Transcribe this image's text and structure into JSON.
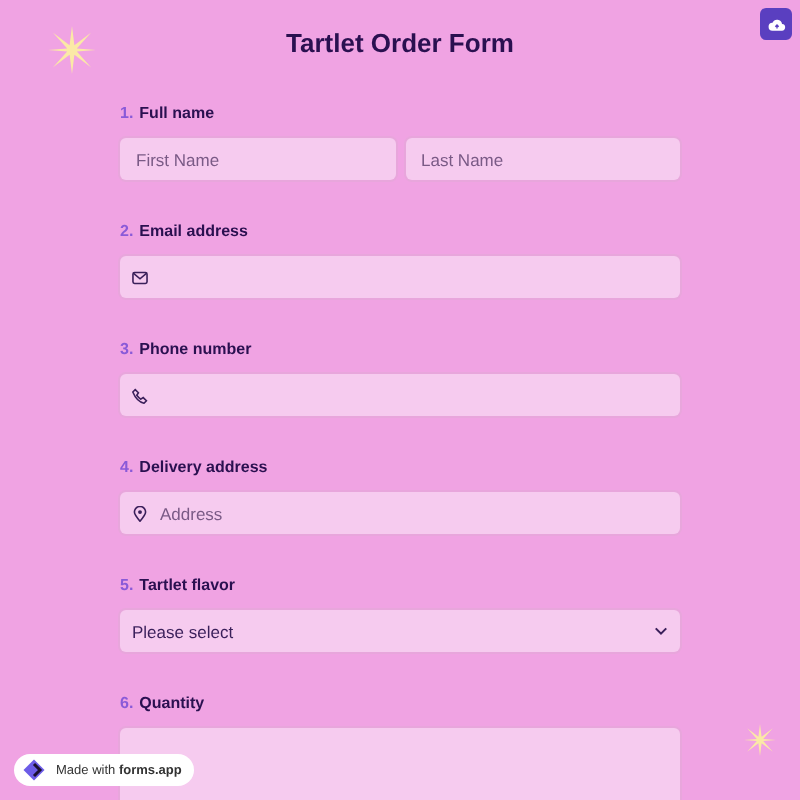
{
  "title": "Tartlet Order Form",
  "questions": [
    {
      "number": "1.",
      "label": "Full name",
      "kind": "name",
      "placeholders": [
        "First Name",
        "Last Name"
      ]
    },
    {
      "number": "2.",
      "label": "Email address",
      "kind": "email"
    },
    {
      "number": "3.",
      "label": "Phone number",
      "kind": "phone"
    },
    {
      "number": "4.",
      "label": "Delivery address",
      "kind": "address",
      "placeholder": "Address"
    },
    {
      "number": "5.",
      "label": "Tartlet flavor",
      "kind": "select",
      "value": "Please select"
    },
    {
      "number": "6.",
      "label": "Quantity",
      "kind": "number"
    }
  ],
  "badge": {
    "text": "Made with **forms.app**"
  }
}
